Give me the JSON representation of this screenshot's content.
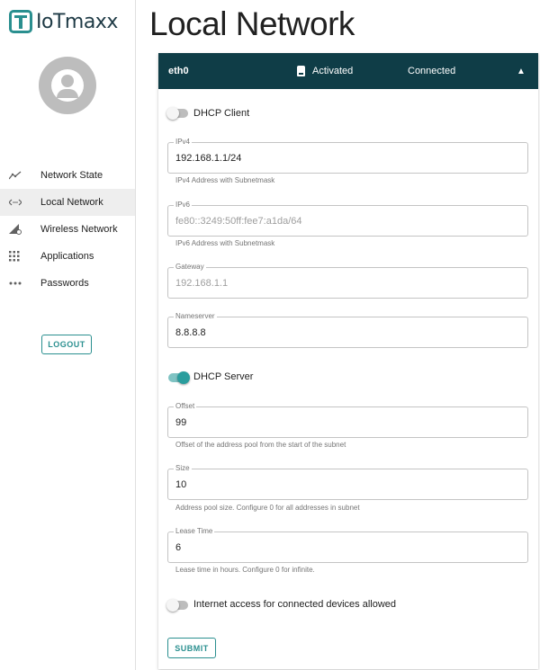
{
  "app": {
    "logo_text": "IoTmaxx"
  },
  "sidebar": {
    "items": [
      {
        "label": "Network State",
        "icon": "chart-line-icon"
      },
      {
        "label": "Local Network",
        "icon": "code-arrows-icon",
        "active": true
      },
      {
        "label": "Wireless Network",
        "icon": "signal-settings-icon"
      },
      {
        "label": "Applications",
        "icon": "apps-grid-icon"
      },
      {
        "label": "Passwords",
        "icon": "dots-icon"
      }
    ],
    "logout_label": "LOGOUT"
  },
  "page": {
    "title": "Local Network"
  },
  "interface": {
    "name": "eth0",
    "state": "Activated",
    "connection": "Connected"
  },
  "dhcp_client": {
    "label": "DHCP Client",
    "enabled": false
  },
  "fields": {
    "ipv4": {
      "label": "IPv4",
      "value": "192.168.1.1/24",
      "helper": "IPv4 Address with Subnetmask"
    },
    "ipv6": {
      "label": "IPv6",
      "value": "fe80::3249:50ff:fee7:a1da/64",
      "helper": "IPv6 Address with Subnetmask"
    },
    "gateway": {
      "label": "Gateway",
      "value": "192.168.1.1"
    },
    "nameserver": {
      "label": "Nameserver",
      "value": "8.8.8.8"
    },
    "offset": {
      "label": "Offset",
      "value": "99",
      "helper": "Offset of the address pool from the start of the subnet"
    },
    "size": {
      "label": "Size",
      "value": "10",
      "helper": "Address pool size. Configure 0 for all addresses in subnet"
    },
    "lease_time": {
      "label": "Lease Time",
      "value": "6",
      "helper": "Lease time in hours. Configure 0 for infinite."
    }
  },
  "dhcp_server": {
    "label": "DHCP Server",
    "enabled": true
  },
  "internet_access": {
    "label": "Internet access for connected devices allowed",
    "enabled": false
  },
  "submit_label": "SUBMIT",
  "colors": {
    "accent": "#2a8f8f",
    "header_bg": "#0f3d47"
  }
}
